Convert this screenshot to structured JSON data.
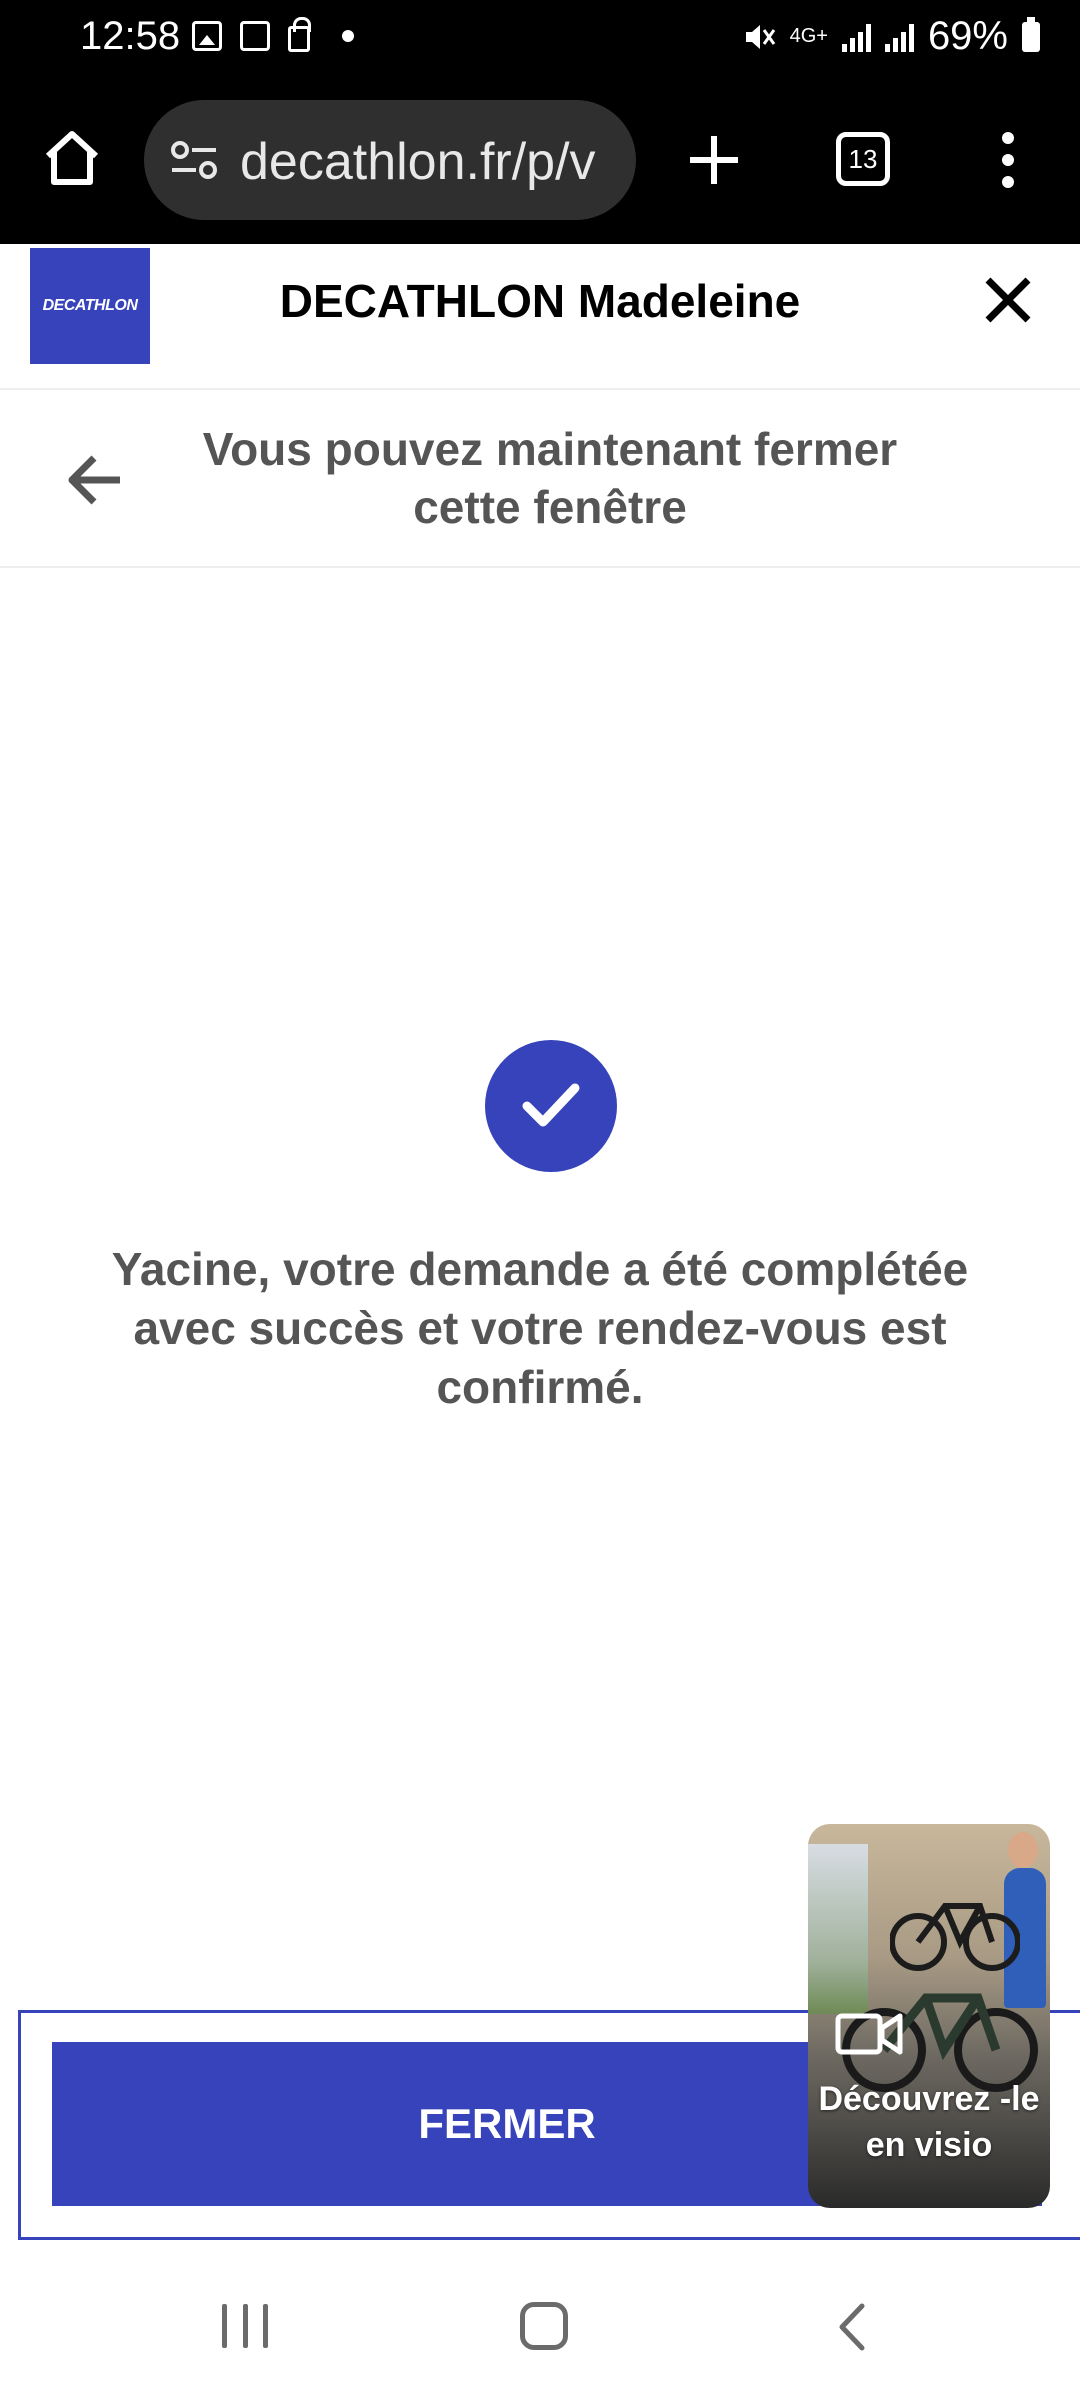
{
  "status_bar": {
    "time": "12:58",
    "network": "4G+",
    "battery": "69%",
    "icons": [
      "gallery-icon",
      "screen-record-icon",
      "lock-icon",
      "notification-dot-icon",
      "mute-icon",
      "signal-icon",
      "battery-icon"
    ]
  },
  "browser": {
    "url": "decathlon.fr/p/v",
    "tab_count": "13",
    "icons": [
      "home-icon",
      "site-settings-icon",
      "new-tab-icon",
      "tabs-icon",
      "menu-icon"
    ]
  },
  "header": {
    "logo_text": "DECATHLON",
    "title": "DECATHLON Madeleine",
    "brand_color": "#3643ba"
  },
  "subheader": {
    "title": "Vous pouvez maintenant fermer cette fenêtre"
  },
  "content": {
    "message": "Yacine, votre demande a été complétée avec succès et votre rendez-vous est confirmé."
  },
  "footer": {
    "close_button_label": "FERMER"
  },
  "video_widget": {
    "label": "Découvrez -le en visio"
  }
}
